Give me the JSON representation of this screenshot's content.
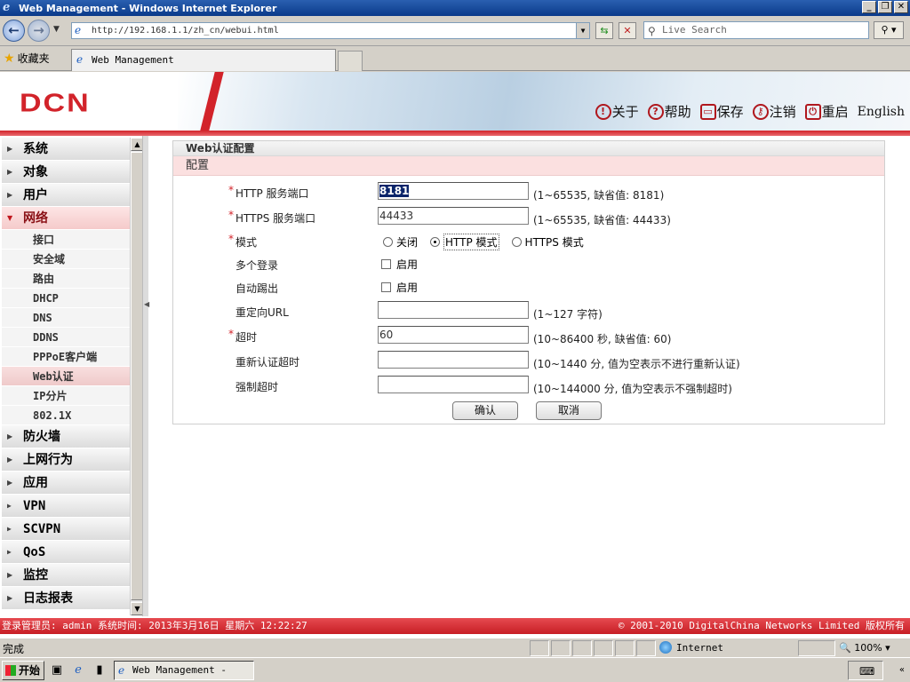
{
  "window": {
    "title": "Web Management - Windows Internet Explorer",
    "address": "http://192.168.1.1/zh_cn/webui.html",
    "search_placeholder": "Live Search",
    "favorites_label": "收藏夹",
    "tab_title": "Web Management"
  },
  "header": {
    "logo_text": "DCN",
    "links": [
      {
        "icon": "info-icon",
        "label": "关于"
      },
      {
        "icon": "help-icon",
        "label": "帮助"
      },
      {
        "icon": "save-icon",
        "label": "保存"
      },
      {
        "icon": "key-icon",
        "label": "注销"
      },
      {
        "icon": "restart-icon",
        "label": "重启"
      }
    ],
    "english_label": "English"
  },
  "sidebar": {
    "categories_top": [
      "系统",
      "对象",
      "用户"
    ],
    "open_category": "网络",
    "sub_items": [
      "接口",
      "安全域",
      "路由",
      "DHCP",
      "DNS",
      "DDNS",
      "PPPoE客户端",
      "Web认证",
      "IP分片",
      "802.1X"
    ],
    "active_sub": "Web认证",
    "categories_bottom": [
      "防火墙",
      "上网行为",
      "应用",
      "VPN",
      "SCVPN",
      "QoS",
      "监控",
      "日志报表"
    ]
  },
  "form": {
    "title": "Web认证配置",
    "section": "配置",
    "http_port": {
      "label": "HTTP 服务端口",
      "value": "8181",
      "hint": "(1~65535, 缺省值: 8181)"
    },
    "https_port": {
      "label": "HTTPS 服务端口",
      "value": "44433",
      "hint": "(1~65535, 缺省值: 44433)"
    },
    "mode": {
      "label": "模式",
      "options": [
        "关闭",
        "HTTP 模式",
        "HTTPS 模式"
      ],
      "selected": "HTTP 模式"
    },
    "multi_login": {
      "label": "多个登录",
      "option": "启用"
    },
    "auto_kick": {
      "label": "自动踢出",
      "option": "启用"
    },
    "redirect_url": {
      "label": "重定向URL",
      "value": "",
      "hint": "(1~127 字符)"
    },
    "timeout": {
      "label": "超时",
      "value": "60",
      "hint": "(10~86400 秒, 缺省值: 60)"
    },
    "reauth_timeout": {
      "label": "重新认证超时",
      "value": "",
      "hint": "(10~1440 分, 值为空表示不进行重新认证)"
    },
    "force_timeout": {
      "label": "强制超时",
      "value": "",
      "hint": "(10~144000 分, 值为空表示不强制超时)"
    },
    "ok_label": "确认",
    "cancel_label": "取消"
  },
  "footer": {
    "left": "登录管理员: admin 系统时间: 2013年3月16日 星期六 12:22:27",
    "right": "© 2001-2010 DigitalChina Networks Limited 版权所有"
  },
  "statusbar": {
    "status": "完成",
    "zone": "Internet",
    "zoom": "100%"
  },
  "taskbar": {
    "start": "开始",
    "task": "Web Management - Wi..."
  }
}
